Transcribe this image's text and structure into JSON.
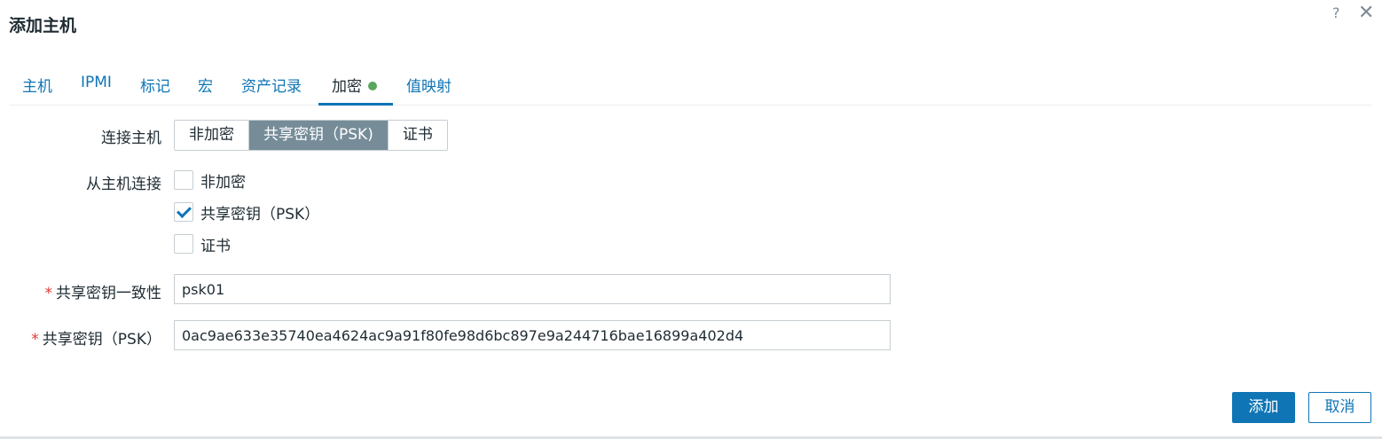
{
  "dialog": {
    "title": "添加主机",
    "help_icon": "?",
    "close_icon": "✕"
  },
  "tabs": [
    {
      "label": "主机"
    },
    {
      "label": "IPMI"
    },
    {
      "label": "标记"
    },
    {
      "label": "宏"
    },
    {
      "label": "资产记录"
    },
    {
      "label": "加密",
      "active": true,
      "status_dot_color": "#59a65e"
    },
    {
      "label": "值映射"
    }
  ],
  "form": {
    "connections_to_host": {
      "label": "连接主机",
      "options": [
        "非加密",
        "共享密钥（PSK)",
        "证书"
      ],
      "selected": "共享密钥（PSK)"
    },
    "connections_from_host": {
      "label": "从主机连接",
      "options": [
        {
          "label": "非加密",
          "checked": false
        },
        {
          "label": "共享密钥（PSK）",
          "checked": true
        },
        {
          "label": "证书",
          "checked": false
        }
      ]
    },
    "psk_identity": {
      "required_mark": "*",
      "label": "共享密钥一致性",
      "value": "psk01"
    },
    "psk": {
      "required_mark": "*",
      "label": "共享密钥（PSK）",
      "value": "0ac9ae633e35740ea4624ac9a91f80fe98d6bc897e9a244716bae16899a402d4"
    }
  },
  "footer": {
    "add_label": "添加",
    "cancel_label": "取消"
  },
  "colors": {
    "accent": "#0f75b5",
    "segment_active": "#768d99",
    "required": "#e33734",
    "status_ok": "#59a65e"
  }
}
